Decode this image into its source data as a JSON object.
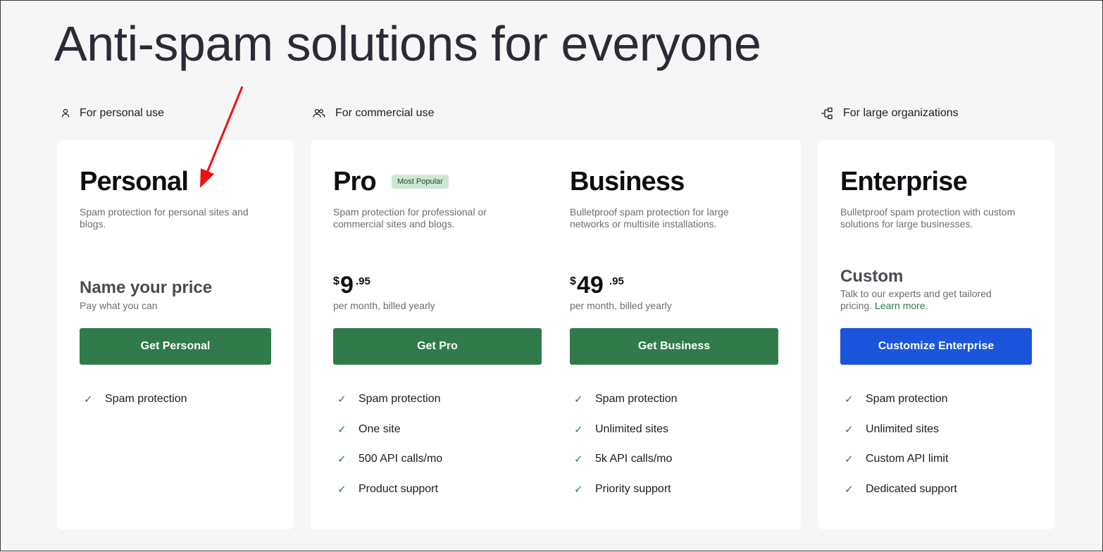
{
  "page": {
    "title": "Anti-spam solutions for everyone"
  },
  "sections": {
    "personal": {
      "label": "For personal use",
      "icon": "person-icon"
    },
    "commercial": {
      "label": "For commercial use",
      "icon": "people-icon"
    },
    "enterprise": {
      "label": "For large organizations",
      "icon": "hierarchy-icon"
    }
  },
  "plans": {
    "personal": {
      "name": "Personal",
      "description": "Spam protection for personal sites and blogs.",
      "price_title": "Name your price",
      "price_note": "Pay what you can",
      "cta": "Get Personal",
      "features": [
        "Spam protection"
      ]
    },
    "pro": {
      "name": "Pro",
      "badge": "Most Popular",
      "description": "Spam protection for professional or commercial sites and blogs.",
      "currency": "$",
      "price": "9",
      "cents": ".95",
      "billing": "per month, billed yearly",
      "cta": "Get Pro",
      "features": [
        "Spam protection",
        "One site",
        "500 API calls/mo",
        "Product support"
      ]
    },
    "business": {
      "name": "Business",
      "description": "Bulletproof spam protection for large networks or multisite installations.",
      "currency": "$",
      "price": "49",
      "cents": ".95",
      "billing": "per month, billed yearly",
      "cta": "Get Business",
      "features": [
        "Spam protection",
        "Unlimited sites",
        "5k API calls/mo",
        "Priority support"
      ]
    },
    "enterprise": {
      "name": "Enterprise",
      "description": "Bulletproof spam protection with custom solutions for large businesses.",
      "price_title": "Custom",
      "price_note": "Talk to our experts and get tailored pricing.",
      "learn_more": "Learn more.",
      "cta": "Customize Enterprise",
      "features": [
        "Spam protection",
        "Unlimited sites",
        "Custom API limit",
        "Dedicated support"
      ]
    }
  },
  "colors": {
    "green_button": "#317a4b",
    "blue_button": "#1a55db",
    "badge_bg": "#cde8d2",
    "annotation_arrow": "#ee1111"
  }
}
